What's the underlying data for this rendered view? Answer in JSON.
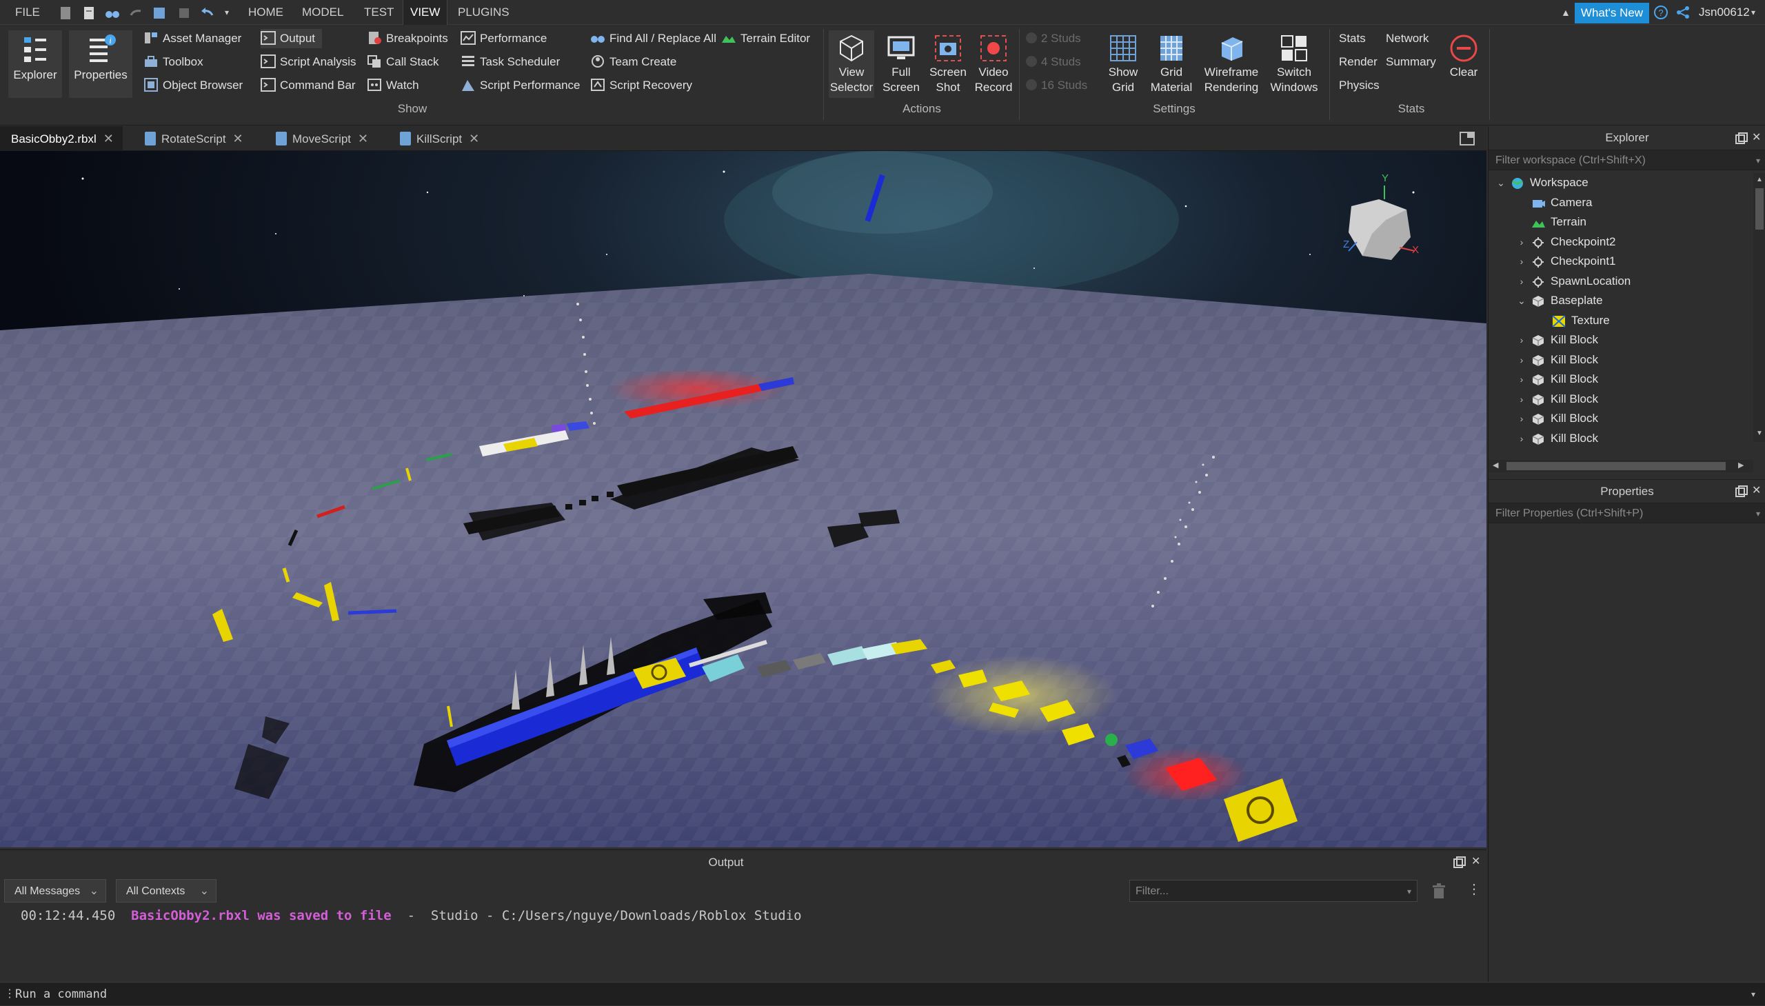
{
  "menubar": {
    "file": "FILE",
    "tabs": [
      "HOME",
      "MODEL",
      "TEST",
      "VIEW",
      "PLUGINS"
    ],
    "active_tab": "VIEW",
    "whats_new": "What's New",
    "user": "Jsn00612"
  },
  "ribbon": {
    "explorer": "Explorer",
    "properties": "Properties",
    "show_items": {
      "asset_manager": "Asset Manager",
      "toolbox": "Toolbox",
      "object_browser": "Object Browser",
      "output": "Output",
      "script_analysis": "Script Analysis",
      "command_bar": "Command Bar",
      "breakpoints": "Breakpoints",
      "call_stack": "Call Stack",
      "watch": "Watch",
      "performance": "Performance",
      "task_scheduler": "Task Scheduler",
      "script_performance": "Script Performance",
      "find_all": "Find All / Replace All",
      "team_create": "Team Create",
      "script_recovery": "Script Recovery",
      "terrain_editor": "Terrain Editor"
    },
    "show_label": "Show",
    "actions": {
      "view_selector": [
        "View",
        "Selector"
      ],
      "full_screen": [
        "Full",
        "Screen"
      ],
      "screen_shot": [
        "Screen",
        "Shot"
      ],
      "video_record": [
        "Video",
        "Record"
      ]
    },
    "actions_label": "Actions",
    "studs": [
      "2 Studs",
      "4 Studs",
      "16 Studs"
    ],
    "settings": {
      "show_grid": [
        "Show",
        "Grid"
      ],
      "grid_material": [
        "Grid",
        "Material"
      ],
      "wireframe": [
        "Wireframe",
        "Rendering"
      ],
      "switch_windows": [
        "Switch",
        "Windows"
      ]
    },
    "settings_label": "Settings",
    "stats": {
      "stats": "Stats",
      "network": "Network",
      "render": "Render",
      "summary": "Summary",
      "physics": "Physics",
      "clear": "Clear"
    },
    "stats_label": "Stats"
  },
  "doc_tabs": [
    {
      "label": "BasicObby2.rbxl",
      "active": true
    },
    {
      "label": "RotateScript",
      "active": false
    },
    {
      "label": "MoveScript",
      "active": false
    },
    {
      "label": "KillScript",
      "active": false
    }
  ],
  "output": {
    "title": "Output",
    "messages_filter": "All Messages",
    "contexts_filter": "All Contexts",
    "filter_placeholder": "Filter...",
    "log": {
      "time": "00:12:44.450",
      "message": "BasicObby2.rbxl was saved to file",
      "sep": "-",
      "source": "Studio - C:/Users/nguye/Downloads/Roblox Studio"
    }
  },
  "command_bar": {
    "placeholder": "Run a command"
  },
  "explorer": {
    "title": "Explorer",
    "filter_placeholder": "Filter workspace (Ctrl+Shift+X)",
    "tree": [
      {
        "label": "Workspace",
        "depth": 0,
        "expander": "open",
        "icon": "globe-icon"
      },
      {
        "label": "Camera",
        "depth": 1,
        "expander": "none",
        "icon": "camera-icon"
      },
      {
        "label": "Terrain",
        "depth": 1,
        "expander": "none",
        "icon": "terrain-icon"
      },
      {
        "label": "Checkpoint2",
        "depth": 1,
        "expander": "closed",
        "icon": "spawn-icon"
      },
      {
        "label": "Checkpoint1",
        "depth": 1,
        "expander": "closed",
        "icon": "spawn-icon"
      },
      {
        "label": "SpawnLocation",
        "depth": 1,
        "expander": "closed",
        "icon": "spawn-icon"
      },
      {
        "label": "Baseplate",
        "depth": 1,
        "expander": "open",
        "icon": "part-icon"
      },
      {
        "label": "Texture",
        "depth": 2,
        "expander": "none",
        "icon": "texture-icon"
      },
      {
        "label": "Kill Block",
        "depth": 1,
        "expander": "closed",
        "icon": "part-icon"
      },
      {
        "label": "Kill Block",
        "depth": 1,
        "expander": "closed",
        "icon": "part-icon"
      },
      {
        "label": "Kill Block",
        "depth": 1,
        "expander": "closed",
        "icon": "part-icon"
      },
      {
        "label": "Kill Block",
        "depth": 1,
        "expander": "closed",
        "icon": "part-icon"
      },
      {
        "label": "Kill Block",
        "depth": 1,
        "expander": "closed",
        "icon": "part-icon"
      },
      {
        "label": "Kill Block",
        "depth": 1,
        "expander": "closed",
        "icon": "part-icon"
      }
    ]
  },
  "properties": {
    "title": "Properties",
    "filter_placeholder": "Filter Properties (Ctrl+Shift+P)"
  },
  "view_cube": {
    "y": "Y",
    "x": "X",
    "z": "Z"
  },
  "colors": {
    "accent": "#1e8fd6",
    "kill_red": "#ff2020",
    "checkpoint_yellow": "#e8d400",
    "path_blue": "#1a2bd6",
    "log_highlight": "#d35fd6"
  }
}
